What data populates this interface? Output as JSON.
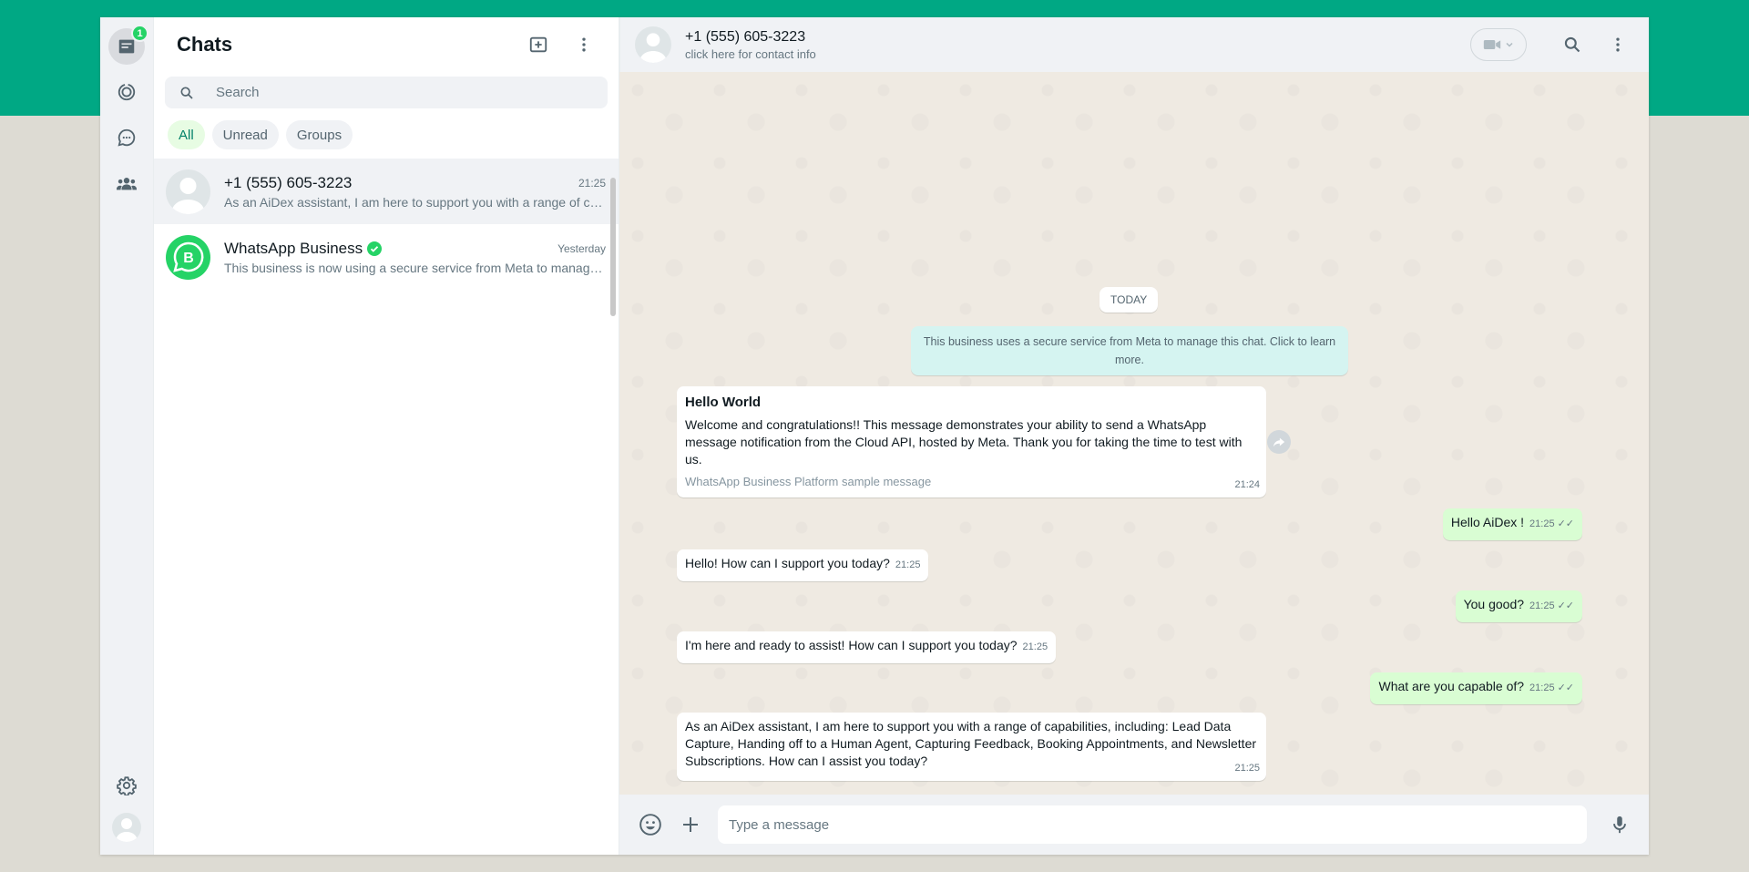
{
  "rail": {
    "chats_badge": "1"
  },
  "list": {
    "title": "Chats",
    "search_placeholder": "Search",
    "filters": [
      "All",
      "Unread",
      "Groups"
    ],
    "chats": [
      {
        "name": "+1 (555) 605-3223",
        "time": "21:25",
        "preview": "As an AiDex assistant, I am here to support you with a range of capabilities, including: Lead Data Capture"
      },
      {
        "name": "WhatsApp Business",
        "time": "Yesterday",
        "preview": "This business is now using a secure service from Meta to manage this chat."
      }
    ]
  },
  "conversation": {
    "contact_name": "+1 (555) 605-3223",
    "contact_sub": "click here for contact info",
    "day_label": "TODAY",
    "system_message": "This business uses a secure service from Meta to manage this chat. Click to learn more.",
    "template": {
      "title": "Hello World",
      "body": "Welcome and congratulations!! This message demonstrates your ability to send a WhatsApp message notification from the Cloud API, hosted by Meta. Thank you for taking the time to test with us.",
      "footer": "WhatsApp Business Platform sample message",
      "time": "21:24"
    },
    "messages": [
      {
        "text": "Hello AiDex !",
        "time": "21:25"
      },
      {
        "text": "Hello! How can I support you today?",
        "time": "21:25"
      },
      {
        "text": "You good?",
        "time": "21:25"
      },
      {
        "text": "I'm here and ready to assist! How can I support you today?",
        "time": "21:25"
      },
      {
        "text": "What are you capable of?",
        "time": "21:25"
      },
      {
        "text": "As an AiDex assistant, I am here to support you with a range of capabilities, including: Lead Data Capture, Handing off to a Human Agent, Capturing Feedback, Booking Appointments, and Newsletter Subscriptions. How can I assist you today?",
        "time": "21:25"
      }
    ],
    "composer_placeholder": "Type a message"
  },
  "colors": {
    "brand": "#00a884",
    "outgoing_bubble": "#d9fdd3",
    "system_bubble": "#d5f4f1",
    "active_chip": "#e7fce3"
  }
}
